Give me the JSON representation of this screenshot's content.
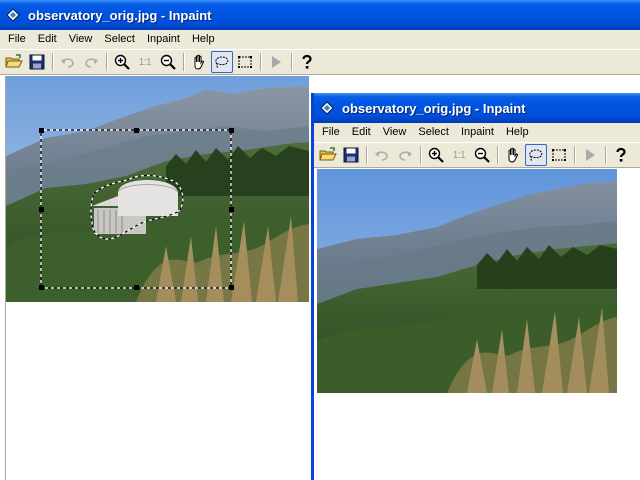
{
  "window_back": {
    "title": "observatory_orig.jpg - Inpaint",
    "menu": [
      "File",
      "Edit",
      "View",
      "Select",
      "Inpaint",
      "Help"
    ],
    "toolbar_zoom_actual": "1:1"
  },
  "window_front": {
    "title": "observatory_orig.jpg - Inpaint",
    "menu": [
      "File",
      "Edit",
      "View",
      "Select",
      "Inpaint",
      "Help"
    ],
    "toolbar_zoom_actual": "1:1"
  },
  "icons": {
    "app": "inpaint-app-icon",
    "open": "open-folder-icon",
    "save": "save-disk-icon",
    "undo": "undo-icon",
    "redo": "redo-icon",
    "zoom_in": "zoom-in-icon",
    "zoom_out": "zoom-out-icon",
    "pan": "hand-pan-icon",
    "lasso": "lasso-select-icon",
    "rect_select": "rectangle-select-icon",
    "run": "run-inpaint-icon",
    "help": "help-icon"
  },
  "colors": {
    "titlebar": "#0054e3",
    "chrome": "#ece9d8",
    "selection": "#000000"
  }
}
